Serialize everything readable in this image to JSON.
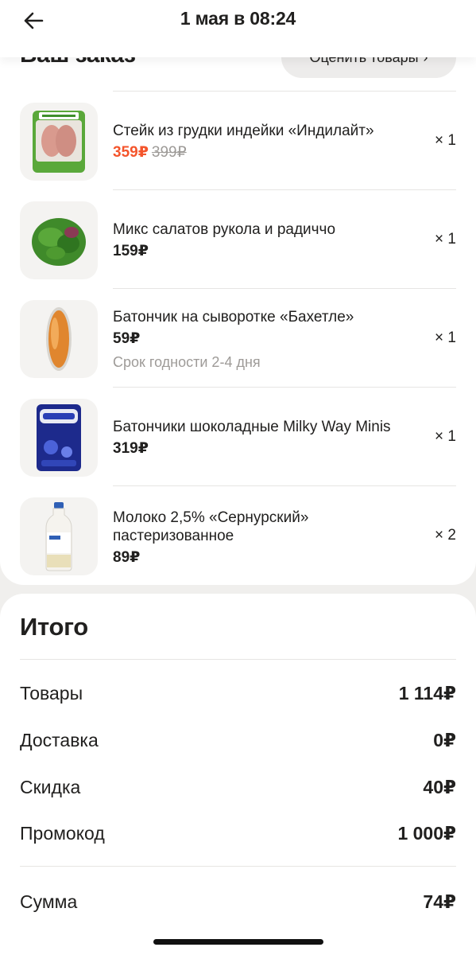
{
  "header": {
    "title": "1 мая в 08:24"
  },
  "order": {
    "title": "Ваш заказ",
    "rate_label": "Оценить товары",
    "items": [
      {
        "name": "Стейк из грудки индейки «Индилайт»",
        "price": "359₽",
        "old_price": "399₽",
        "qty": "× 1",
        "thumb": "turkey-steak-pack-image"
      },
      {
        "name": "Микс салатов рукола и радиччо",
        "price": "159₽",
        "qty": "× 1",
        "thumb": "salad-mix-image"
      },
      {
        "name": "Батончик на сыворотке «Бахетле»",
        "price": "59₽",
        "note": "Срок годности 2-4 дня",
        "qty": "× 1",
        "thumb": "whey-bar-image"
      },
      {
        "name": "Батончики шоколадные Milky Way Minis",
        "price": "319₽",
        "qty": "× 1",
        "thumb": "milky-way-pack-image"
      },
      {
        "name": "Молоко 2,5% «Сернурский» пастеризованное",
        "price": "89₽",
        "qty": "× 2",
        "thumb": "milk-bottle-image"
      }
    ]
  },
  "totals": {
    "title": "Итого",
    "rows": [
      {
        "label": "Товары",
        "value": "1 114₽"
      },
      {
        "label": "Доставка",
        "value": "0₽"
      },
      {
        "label": "Скидка",
        "value": "40₽"
      },
      {
        "label": "Промокод",
        "value": "1 000₽"
      }
    ],
    "sum": {
      "label": "Сумма",
      "value": "74₽"
    }
  },
  "colors": {
    "accent_price": "#f4552c",
    "muted": "#9e9b98",
    "background": "#f0efed"
  }
}
